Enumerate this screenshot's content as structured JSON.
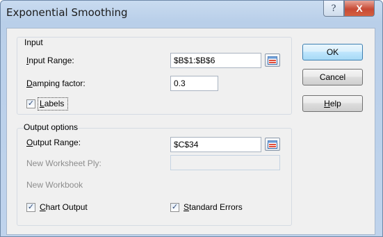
{
  "window": {
    "title": "Exponential Smoothing"
  },
  "titlebar": {
    "help_glyph": "?",
    "close_glyph": "X",
    "help_icon": "question-mark-icon",
    "close_icon": "close-x-icon"
  },
  "input_group": {
    "title": "Input",
    "input_range": {
      "label_u": "I",
      "label_rest": "nput Range:",
      "value": "$B$1:$B$6"
    },
    "damping_factor": {
      "label_u": "D",
      "label_rest": "amping factor:",
      "value": "0.3"
    },
    "labels": {
      "label_u": "L",
      "label_rest": "abels",
      "checked": true
    }
  },
  "output_group": {
    "title": "Output options",
    "output_range": {
      "label_u": "O",
      "label_rest": "utput Range:",
      "value": "$C$34"
    },
    "new_worksheet_ply": {
      "label": "New Worksheet Ply:",
      "value": ""
    },
    "new_workbook": {
      "label": "New Workbook"
    },
    "chart_output": {
      "label_u": "C",
      "label_rest": "hart Output",
      "checked": true
    },
    "standard_errors": {
      "label_u": "S",
      "label_rest": "tandard Errors",
      "checked": true
    }
  },
  "buttons": {
    "ok": "OK",
    "cancel": "Cancel",
    "help_u": "H",
    "help_rest": "elp"
  },
  "colors": {
    "title_bar": "#bfd3ec",
    "close_button": "#c74a35",
    "default_button": "#3c7fb1",
    "dialog_background": "#f0f0f0"
  }
}
